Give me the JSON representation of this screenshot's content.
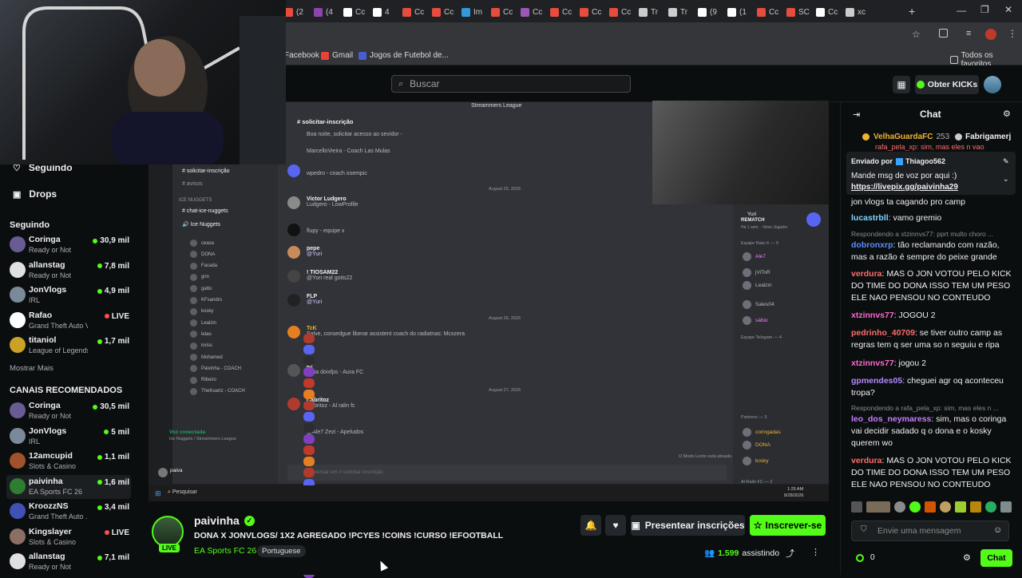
{
  "browser": {
    "tabs": [
      {
        "label": "(2",
        "color": "#e74c3c"
      },
      {
        "label": "(4",
        "color": "#8e44ad"
      },
      {
        "label": "Cc",
        "color": "#ffffff"
      },
      {
        "label": "4",
        "color": "#ffffff"
      },
      {
        "label": "Cc",
        "color": "#e74c3c"
      },
      {
        "label": "Cc",
        "color": "#e74c3c"
      },
      {
        "label": "Im",
        "color": "#3498db"
      },
      {
        "label": "Cc",
        "color": "#e74c3c"
      },
      {
        "label": "Cc",
        "color": "#9b59b6"
      },
      {
        "label": "Cc",
        "color": "#e74c3c"
      },
      {
        "label": "Cc",
        "color": "#e74c3c"
      },
      {
        "label": "Cc",
        "color": "#e74c3c"
      },
      {
        "label": "Tr",
        "color": "#cccccc"
      },
      {
        "label": "Tr",
        "color": "#cccccc"
      },
      {
        "label": "(9",
        "color": "#ffffff"
      },
      {
        "label": "(1",
        "color": "#ffffff"
      },
      {
        "label": "Cc",
        "color": "#e74c3c"
      },
      {
        "label": "SC",
        "color": "#e74c3c"
      },
      {
        "label": "Cc",
        "color": "#ffffff"
      },
      {
        "label": "xc",
        "color": "#cccccc"
      }
    ],
    "bookmarks": [
      {
        "label": "Facebook",
        "color": ""
      },
      {
        "label": "Gmail",
        "color": "#ea4335"
      },
      {
        "label": "Jogos de Futebol de...",
        "color": "#4a5bd6"
      }
    ],
    "all_bookmarks": "Todos os favoritos"
  },
  "header": {
    "search_placeholder": "Buscar",
    "get_kicks": "Obter KICKs"
  },
  "sidebar": {
    "following_nav": "Seguindo",
    "drops_nav": "Drops",
    "following_title": "Seguindo",
    "following": [
      {
        "name": "Coringa",
        "game": "Ready or Not",
        "viewers": "30,9 mil",
        "color": "#6b5b95"
      },
      {
        "name": "allanstag",
        "game": "Ready or Not",
        "viewers": "7,8 mil",
        "color": "#e0e0e0"
      },
      {
        "name": "JonVlogs",
        "game": "IRL",
        "viewers": "4,9 mil",
        "color": "#7a8a9a"
      },
      {
        "name": "Rafao",
        "game": "Grand Theft Auto V (...",
        "viewers": "LIVE",
        "color": "#ffffff"
      },
      {
        "name": "titaniol",
        "game": "League of Legends",
        "viewers": "1,7 mil",
        "color": "#c9a227"
      }
    ],
    "show_more": "Mostrar Mais",
    "recommended_title": "CANAIS RECOMENDADOS",
    "recommended": [
      {
        "name": "Coringa",
        "game": "Ready or Not",
        "viewers": "30,5 mil",
        "color": "#6b5b95"
      },
      {
        "name": "JonVlogs",
        "game": "IRL",
        "viewers": "5 mil",
        "color": "#7a8a9a"
      },
      {
        "name": "12amcupid",
        "game": "Slots & Casino",
        "viewers": "1,1 mil",
        "color": "#a0522d"
      },
      {
        "name": "paivinha",
        "game": "EA Sports FC 26",
        "viewers": "1,6 mil",
        "color": "#2e7d32"
      },
      {
        "name": "KroozzNS",
        "game": "Grand Theft Auto ...",
        "viewers": "3,4 mil",
        "color": "#3f51b5"
      },
      {
        "name": "Kingslayer",
        "game": "Slots & Casino",
        "viewers": "LIVE",
        "color": "#8d6e63"
      },
      {
        "name": "allanstag",
        "game": "Ready or Not",
        "viewers": "7,1 mil",
        "color": "#e0e0e0"
      }
    ]
  },
  "video": {
    "server_name": "Streammers League",
    "channels": [
      "solicitar-inscrição",
      "avisos",
      "ICE NUGGETS",
      "chat-ice-nuggets",
      "Ice Nuggets"
    ],
    "voice_members": [
      "ceasa",
      "DONA",
      "Facada",
      "gnn",
      "gatto",
      "KFsandro",
      "kosky",
      "Lealzin",
      "lelao",
      "loriss",
      "Mohamed",
      "Paivinha - COACH",
      "Ribeiro",
      "TheKuartz - COACH"
    ],
    "voice_status": "Voz conectada",
    "voice_channel": "Ice Nuggets / Streammers League",
    "user_name": "paiva",
    "channel_header": "solicitar-inscrição",
    "messages": [
      {
        "name": "",
        "text": "Boa noite, solicitar acesso ao sevidor -"
      },
      {
        "name": "",
        "text": "MarcelloVieira - Coach Las Mulas"
      },
      {
        "name": "",
        "text": "wpedro - coach osempic"
      },
      {
        "name": "Victor Ludgero",
        "text": "Ludgero - LowProfile"
      },
      {
        "name": "",
        "text": "flupy - equipe x"
      },
      {
        "name": "pepe",
        "text": "@Yuri"
      },
      {
        "name": "! TIOSAM22",
        "text": "@Yuri real gotis22"
      },
      {
        "name": "FLP",
        "text": "@Yuri"
      },
      {
        "name": "TcK",
        "text": "Salve, consedgue liberar assistent coach do radiatnas: Mcxzera"
      },
      {
        "name": "62",
        "text": "meia doixfps - Aura FC"
      },
      {
        "name": "Cabritoz",
        "text": "Cabritoz - Al ralin fc"
      },
      {
        "name": "",
        "text": "@Ale7 Zezi - Apeludos"
      }
    ],
    "dates": [
      "August 25, 2026",
      "August 26, 2026",
      "August 27, 2026"
    ],
    "input_placeholder": "Conversar em # solicitar-inscrição",
    "slow_mode": "O Modo Lento está ativado.",
    "right_user": "Yuri",
    "right_status": "REMATCH",
    "right_sub": "Há 1 sem. · Novo Jogador",
    "right_groups": [
      "Equipe Raio-X — 5",
      "Equipe Telegam — 4",
      "Partners — 3",
      "Al Ralin FC — 2"
    ],
    "right_members": [
      "Ale7",
      "jViToR",
      "Lealzin",
      "Sales04",
      "sábio",
      "coringadas",
      "DONA",
      "kosky"
    ],
    "taskbar_search": "Pesquisar",
    "taskbar_time": "1:25 AM",
    "taskbar_date": "8/28/2026"
  },
  "stream": {
    "streamer": "paivinha",
    "live_badge": "LIVE",
    "title": "DONA X JONVLOGS/ 1X2 AGREGADO  !PCYES !COINS !CURSO !EFOOTBALL",
    "category": "EA Sports FC 26",
    "language": "Portuguese",
    "gift_subs": "Presentear inscrições",
    "subscribe": "Inscrever-se",
    "viewers": "1.599",
    "viewers_label": "assistindo"
  },
  "chat": {
    "title": "Chat",
    "top_gifters": [
      {
        "name": "VelhaGuardaFC",
        "count": "253"
      },
      {
        "name": "Fabrigamerj",
        "count": ""
      }
    ],
    "pinned_partial": "rafa_pela_xp: sim, mas eles n vao",
    "pinned_by": "Enviado por",
    "pinned_user": "Thiagoo562",
    "pinned_text": "Mande msg de voz por aqui :)",
    "pinned_link": "https://livepix.gg/paivinha29",
    "messages": [
      {
        "reply": "",
        "user": "",
        "color": "#efeff1",
        "text": "jon vlogs ta cagando pro camp"
      },
      {
        "reply": "",
        "user": "lucastrbll",
        "color": "#7fd4ff",
        "text": "vamo gremio"
      },
      {
        "reply": "Respondendo a xtzinnvs77: pprt multo choro ...",
        "user": "dobronxrp",
        "color": "#5b8cff",
        "text": "tão reclamando com razão, mas a razão é sempre do peixe grande"
      },
      {
        "reply": "",
        "user": "verdura",
        "color": "#ff6b6b",
        "text": "MAS O JON VOTOU PELO KICK DO TIME DO DONA ISSO TEM UM PESO ELE NAO PENSOU NO CONTEUDO"
      },
      {
        "reply": "",
        "user": "xtzinnvs77",
        "color": "#ff66cc",
        "text": "JOGOU 2"
      },
      {
        "reply": "",
        "user": "pedrinho_40709",
        "color": "#ff6b6b",
        "text": "se tiver outro camp as regras tem q ser uma so n seguiu e ripa"
      },
      {
        "reply": "",
        "user": "xtzinnvs77",
        "color": "#ff66cc",
        "text": "jogou 2"
      },
      {
        "reply": "",
        "user": "gpmendes05",
        "color": "#b388ff",
        "text": "cheguei agr oq aconteceu tropa?"
      },
      {
        "reply": "Respondendo a rafa_pela_xp: sim, mas eles n ...",
        "user": "leo_dos_neymaress",
        "color": "#c77dff",
        "text": "sim, mas o coringa vai decidir sadado q o dona e o kosky querem wo"
      },
      {
        "reply": "",
        "user": "verdura",
        "color": "#ff6b6b",
        "text": "MAS O JON VOTOU PELO KICK DO TIME DO DONA ISSO TEM UM PESO ELE NAO PENSOU NO CONTEUDO"
      }
    ],
    "input_placeholder": "Envie uma mensagem",
    "points": "0",
    "send": "Chat"
  },
  "colors": {
    "kick_green": "#53fc18",
    "bg": "#0b0e0f"
  }
}
